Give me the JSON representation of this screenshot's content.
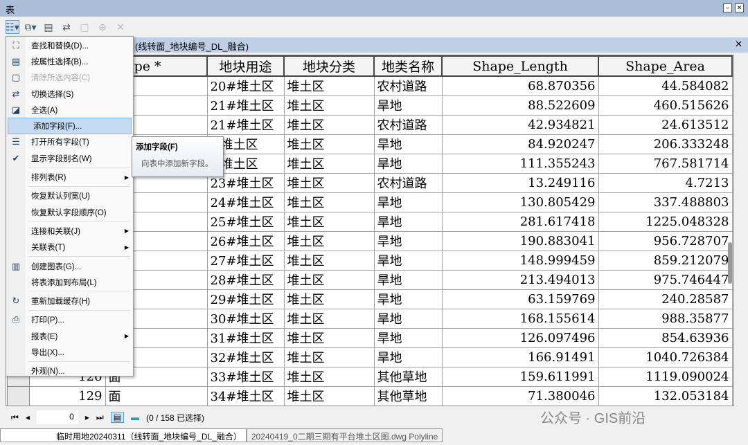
{
  "window": {
    "title": "表"
  },
  "tab": {
    "label": "(线转面_地块编号_DL_融合)"
  },
  "columns": [
    "",
    "",
    "Shape *",
    "地块用途",
    "地块分类",
    "地类名称",
    "Shape_Length",
    "Shape_Area"
  ],
  "rows": [
    {
      "fid": "",
      "shape": "",
      "yt": "20#堆土区",
      "fl": "堆土区",
      "mc": "农村道路",
      "len": "68.870356",
      "area": "44.584082"
    },
    {
      "fid": "",
      "shape": "",
      "yt": "21#堆土区",
      "fl": "堆土区",
      "mc": "旱地",
      "len": "88.522609",
      "area": "460.515626"
    },
    {
      "fid": "",
      "shape": "",
      "yt": "21#堆土区",
      "fl": "堆土区",
      "mc": "农村道路",
      "len": "42.934821",
      "area": "24.613512"
    },
    {
      "fid": "",
      "shape": "",
      "yt": "#堆土区",
      "fl": "堆土区",
      "mc": "旱地",
      "len": "84.920247",
      "area": "206.333248"
    },
    {
      "fid": "",
      "shape": "",
      "yt": "#堆土区",
      "fl": "堆土区",
      "mc": "旱地",
      "len": "111.355243",
      "area": "767.581714"
    },
    {
      "fid": "",
      "shape": "",
      "yt": "23#堆土区",
      "fl": "堆土区",
      "mc": "农村道路",
      "len": "13.249116",
      "area": "4.7213"
    },
    {
      "fid": "",
      "shape": "",
      "yt": "24#堆土区",
      "fl": "堆土区",
      "mc": "旱地",
      "len": "130.805429",
      "area": "337.488803"
    },
    {
      "fid": "",
      "shape": "",
      "yt": "25#堆土区",
      "fl": "堆土区",
      "mc": "旱地",
      "len": "281.617418",
      "area": "1225.048328"
    },
    {
      "fid": "",
      "shape": "",
      "yt": "26#堆土区",
      "fl": "堆土区",
      "mc": "旱地",
      "len": "190.883041",
      "area": "956.728707"
    },
    {
      "fid": "",
      "shape": "",
      "yt": "27#堆土区",
      "fl": "堆土区",
      "mc": "旱地",
      "len": "148.999459",
      "area": "859.212079"
    },
    {
      "fid": "",
      "shape": "",
      "yt": "28#堆土区",
      "fl": "堆土区",
      "mc": "旱地",
      "len": "213.494013",
      "area": "975.746447"
    },
    {
      "fid": "",
      "shape": "",
      "yt": "29#堆土区",
      "fl": "堆土区",
      "mc": "旱地",
      "len": "63.159769",
      "area": "240.28587"
    },
    {
      "fid": "",
      "shape": "",
      "yt": "30#堆土区",
      "fl": "堆土区",
      "mc": "旱地",
      "len": "168.155614",
      "area": "988.35877"
    },
    {
      "fid": "",
      "shape": "",
      "yt": "31#堆土区",
      "fl": "堆土区",
      "mc": "旱地",
      "len": "126.097496",
      "area": "854.63936"
    },
    {
      "fid": "",
      "shape": "",
      "yt": "32#堆土区",
      "fl": "堆土区",
      "mc": "旱地",
      "len": "166.91491",
      "area": "1040.726384"
    },
    {
      "fid": "126",
      "shape": "面",
      "yt": "33#堆土区",
      "fl": "堆土区",
      "mc": "其他草地",
      "len": "159.611991",
      "area": "1119.090024"
    },
    {
      "fid": "129",
      "shape": "面",
      "yt": "34#堆土区",
      "fl": "堆土区",
      "mc": "其他草地",
      "len": "71.380046",
      "area": "132.053184"
    }
  ],
  "menu": [
    {
      "label": "查找和替换(D)...",
      "icon": "binoculars-icon",
      "glyph": "⛶"
    },
    {
      "label": "按属性选择(B)...",
      "icon": "select-by-attributes-icon",
      "glyph": "▤"
    },
    {
      "label": "清除所选内容(C)",
      "icon": "clear-selection-icon",
      "glyph": "▢",
      "disabled": true
    },
    {
      "label": "切换选择(S)",
      "icon": "switch-selection-icon",
      "glyph": "⇄"
    },
    {
      "label": "全选(A)",
      "icon": "select-all-icon",
      "glyph": "◪"
    },
    {
      "label": "添加字段(F)...",
      "highlight": true
    },
    {
      "label": "打开所有字段(T)",
      "icon": "fields-list-icon",
      "glyph": "☰"
    },
    {
      "label": "显示字段别名(W)",
      "icon": "check-icon",
      "glyph": "✔",
      "sep": true
    },
    {
      "label": "排列表(R)",
      "submenu": true,
      "sep": true
    },
    {
      "label": "恢复默认列宽(U)"
    },
    {
      "label": "恢复默认字段顺序(O)",
      "sep": true
    },
    {
      "label": "连接和关联(J)",
      "submenu": true
    },
    {
      "label": "关联表(T)",
      "submenu": true,
      "sep": true
    },
    {
      "label": "创建图表(G)...",
      "icon": "bar-chart-icon",
      "glyph": "▥"
    },
    {
      "label": "将表添加到布局(L)",
      "sep": true
    },
    {
      "label": "重新加载缓存(H)",
      "icon": "refresh-icon",
      "glyph": "↻",
      "sep": true
    },
    {
      "label": "打印(P)...",
      "icon": "printer-icon",
      "glyph": "⎙"
    },
    {
      "label": "报表(E)",
      "submenu": true
    },
    {
      "label": "导出(X)...",
      "sep": true
    },
    {
      "label": "外观(N)..."
    }
  ],
  "tooltip": {
    "title": "添加字段(F)",
    "desc": "向表中添加新字段。"
  },
  "footer": {
    "record": "0",
    "status": "(0 / 158 已选择)"
  },
  "bottom_tabs": [
    "临时用地20240311（线转面_地块编号_DL_融合）",
    "20240419_0二期三期有平台堆土区图.dwg Polyline"
  ],
  "watermark": "公众号 · GIS前沿"
}
